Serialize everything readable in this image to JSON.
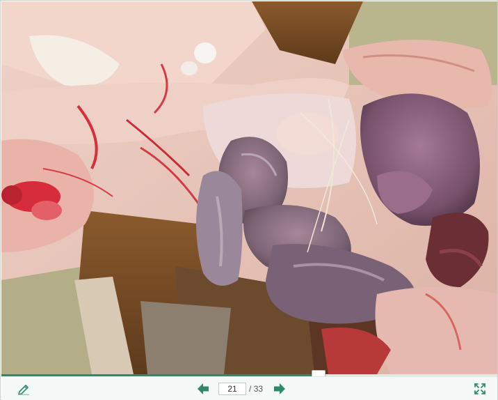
{
  "viewer": {
    "current_page": "21",
    "page_separator": "/",
    "total_pages": "33",
    "progress": 0.64
  },
  "icons": {
    "edit": "pencil-icon",
    "prev": "arrow-left-icon",
    "next": "arrow-right-icon",
    "fullscreen": "fullscreen-icon"
  },
  "colors": {
    "accent": "#2f8a6d",
    "toolbar_bg": "#f4f8f6",
    "icon": "#2f8a6d"
  }
}
